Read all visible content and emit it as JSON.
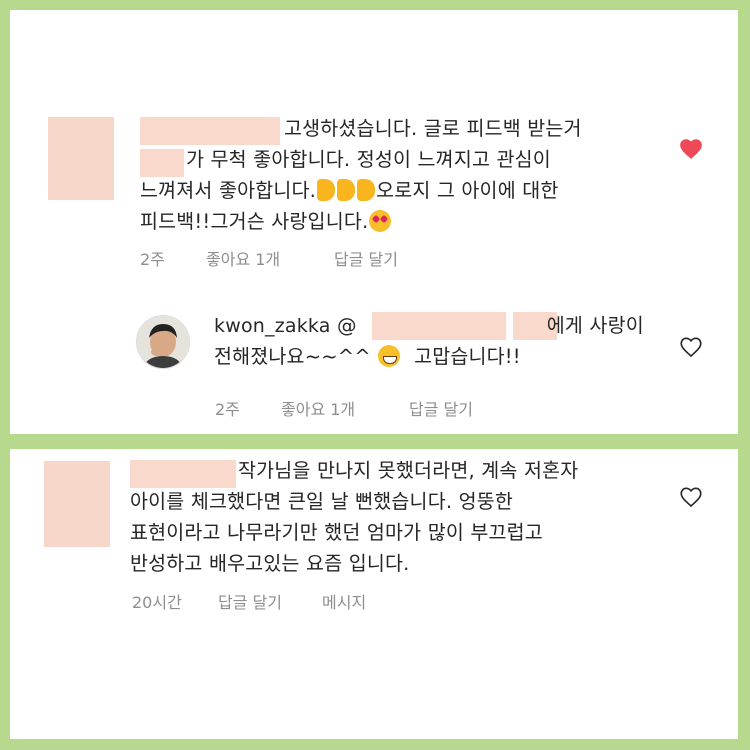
{
  "comments": [
    {
      "text_lines": [
        "고생하셨습니다. 글로 피드백 받는거",
        "가 무척  좋아합니다. 정성이 느껴지고 관심이",
        "느껴져서 좋아합니다.",
        "오로지 그 아이에 대한",
        "피드백!!그거슨 사랑입니다."
      ],
      "meta": {
        "time": "2주",
        "likes": "좋아요 1개",
        "reply": "답글 달기"
      },
      "liked": true
    },
    {
      "username": "kwon_zakka",
      "mention_prefix": "@",
      "text_lines": [
        "에게 사랑이",
        "전해졌나요~~^^",
        "고맙습니다!!"
      ],
      "meta": {
        "time": "2주",
        "likes": "좋아요 1개",
        "reply": "답글 달기"
      },
      "liked": false
    },
    {
      "text_lines": [
        "작가님을 만나지 못했더라면, 계속 저혼자",
        "아이를 체크했다면 큰일 날 뻔했습니다.  엉뚱한",
        "표현이라고 나무라기만 했던 엄마가 많이 부끄럽고",
        "반성하고 배우고있는 요즘 입니다."
      ],
      "meta": {
        "time": "20시간",
        "reply": "답글 달기",
        "message": "메시지"
      },
      "liked": false
    }
  ],
  "icons": {
    "liked_heart": "heart-filled-icon",
    "unliked_heart": "heart-outline-icon",
    "thumbs_up": "thumbs-up-emoji",
    "heart_eyes": "heart-eyes-emoji",
    "grinning": "grinning-emoji"
  },
  "colors": {
    "background_frame": "#b7d98e",
    "heart_red": "#ed4956",
    "redaction": "#f9d9cc",
    "meta_gray": "#8e8e8e"
  }
}
